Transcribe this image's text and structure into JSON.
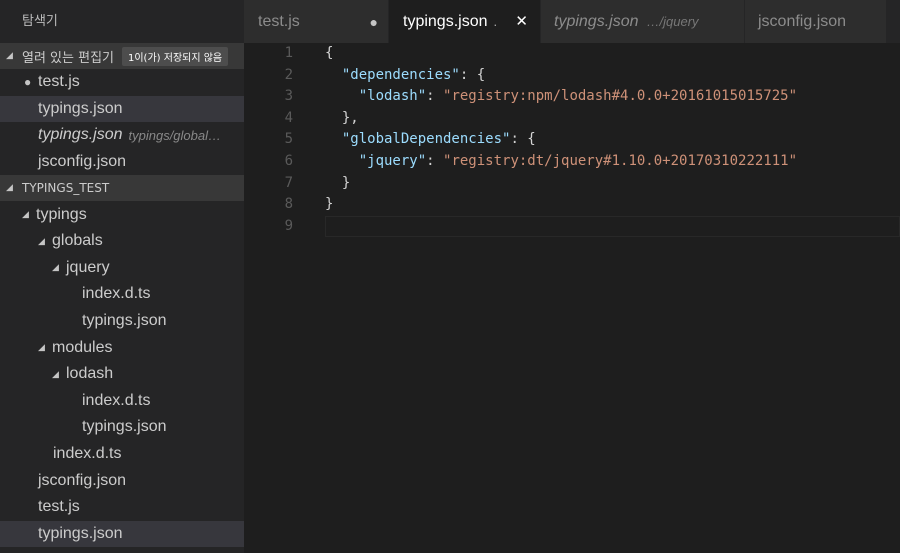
{
  "sidebar": {
    "title": "탐색기",
    "open_editors": {
      "label": "열려 있는 편집기",
      "badge": "1이(가) 저장되지 않음",
      "items": [
        {
          "name": "test.js",
          "dirty": true
        },
        {
          "name": "typings.json",
          "selected": true
        },
        {
          "name": "typings.json",
          "desc": "typings/global…",
          "italic": true
        },
        {
          "name": "jsconfig.json"
        }
      ]
    },
    "workspace": {
      "label": "TYPINGS_TEST",
      "tree": [
        {
          "name": "typings",
          "type": "folder"
        },
        {
          "name": "globals",
          "type": "folder"
        },
        {
          "name": "jquery",
          "type": "folder"
        },
        {
          "name": "index.d.ts",
          "type": "file"
        },
        {
          "name": "typings.json",
          "type": "file"
        },
        {
          "name": "modules",
          "type": "folder"
        },
        {
          "name": "lodash",
          "type": "folder"
        },
        {
          "name": "index.d.ts",
          "type": "file"
        },
        {
          "name": "typings.json",
          "type": "file"
        },
        {
          "name": "index.d.ts",
          "type": "file"
        },
        {
          "name": "jsconfig.json",
          "type": "file"
        },
        {
          "name": "test.js",
          "type": "file"
        },
        {
          "name": "typings.json",
          "type": "file",
          "selected": true
        }
      ]
    }
  },
  "tabs": [
    {
      "label": "test.js",
      "dirty": true
    },
    {
      "label": "typings.json",
      "desc": ".",
      "active": true
    },
    {
      "label": "typings.json",
      "desc": "…/jquery",
      "italic": true
    },
    {
      "label": "jsconfig.json"
    }
  ],
  "editor": {
    "line_numbers": [
      "1",
      "2",
      "3",
      "4",
      "5",
      "6",
      "7",
      "8",
      "9"
    ],
    "lines": [
      "{",
      "  \"dependencies\": {",
      "    \"lodash\": \"registry:npm/lodash#4.0.0+20161015015725\"",
      "  },",
      "  \"globalDependencies\": {",
      "    \"jquery\": \"registry:dt/jquery#1.10.0+20170310222111\"",
      "  }",
      "}",
      ""
    ]
  },
  "colors": {
    "key": "#9cdcfe",
    "string": "#ce9178",
    "selection": "#37373d"
  }
}
